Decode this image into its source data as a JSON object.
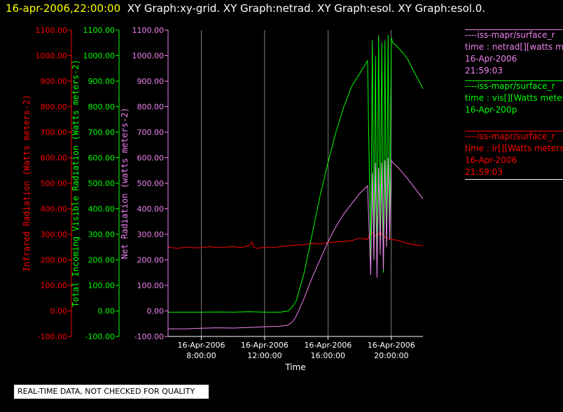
{
  "header": {
    "date": "16-apr-2006,22:00:00",
    "graphs": "XY Graph:xy-grid.  XY Graph:netrad.  XY Graph:esol.  XY Graph:esol.0."
  },
  "legend": [
    {
      "source": "----iss-mapr/surface_r",
      "variable": "time : netrad[][watts me",
      "date": "16-Apr-2006",
      "time": "21:59:03",
      "color": "#ee82ee"
    },
    {
      "source": "----iss-mapr/surface_r",
      "variable": "time : vis[][Watts meters",
      "date": "16-Apr-200p",
      "time": "",
      "color": "#00ff00"
    },
    {
      "source": "----iss-mapr/surface_r",
      "variable": "time : ir[][Watts meters",
      "date": "16-Apr-2006",
      "time": "21:59:03",
      "color": "#ff0000"
    }
  ],
  "disclaimer": "REAL-TIME DATA, NOT CHECKED FOR QUALITY",
  "colors": {
    "ir": "#ff0000",
    "vis": "#00ff00",
    "netrad": "#ee82ee",
    "grid": "#ffffff",
    "axis": "#ffffff"
  },
  "chart_data": {
    "type": "line",
    "xlabel": "Time",
    "x_ticks": [
      {
        "date": "16-Apr-2006",
        "time": "8:00:00",
        "hour": 8
      },
      {
        "date": "16-Apr-2006",
        "time": "12:00:00",
        "hour": 12
      },
      {
        "date": "16-Apr-2006",
        "time": "16:00:00",
        "hour": 16
      },
      {
        "date": "16-Apr-2006",
        "time": "20:00:00",
        "hour": 20
      }
    ],
    "xlim_hours": [
      5.9,
      22.0
    ],
    "y_axes": [
      {
        "key": "ir",
        "label": "Infrared Radiation (Watts meters-2)",
        "color": "#ff0000",
        "ticks": [
          "1100.00",
          "1000.00",
          "900.00",
          "800.00",
          "700.00",
          "600.00",
          "500.00",
          "400.00",
          "300.00",
          "200.00",
          "100.00",
          "0.00",
          "-100.00"
        ]
      },
      {
        "key": "vis",
        "label": "Total Incoming Visible Radiation (Watts meters-2)",
        "color": "#00ff00",
        "ticks": [
          "1100.00",
          "1000.00",
          "900.00",
          "800.00",
          "700.00",
          "600.00",
          "500.00",
          "400.00",
          "300.00",
          "200.00",
          "100.00",
          "0.00",
          "-100.00"
        ]
      },
      {
        "key": "netrad",
        "label": "Net Radiation (watts meters-2)",
        "color": "#ee82ee",
        "ticks": [
          "1100.00",
          "1000.00",
          "900.00",
          "800.00",
          "700.00",
          "600.00",
          "500.00",
          "400.00",
          "300.00",
          "200.00",
          "100.00",
          "0.00",
          "-100.00"
        ]
      }
    ],
    "ylim": [
      -100,
      1100
    ],
    "grid": true,
    "series": [
      {
        "key": "ir",
        "color": "#ff0000",
        "x": [
          5.9,
          6.5,
          7.0,
          7.5,
          8.0,
          8.5,
          9.0,
          9.5,
          10.0,
          10.5,
          11.0,
          11.2,
          11.3,
          11.5,
          12.0,
          12.5,
          13.0,
          13.5,
          14.0,
          14.5,
          15.0,
          15.5,
          16.0,
          16.5,
          17.0,
          17.5,
          18.0,
          18.5,
          18.7,
          18.9,
          19.1,
          19.3,
          19.5,
          19.7,
          20.0,
          20.5,
          21.0,
          21.5,
          22.0
        ],
        "y": [
          250,
          245,
          250,
          247,
          248,
          252,
          248,
          250,
          252,
          248,
          255,
          270,
          250,
          245,
          250,
          248,
          252,
          255,
          258,
          260,
          265,
          262,
          268,
          270,
          272,
          275,
          285,
          280,
          310,
          300,
          290,
          310,
          295,
          285,
          280,
          275,
          265,
          258,
          255
        ]
      },
      {
        "key": "vis",
        "color": "#00ff00",
        "x": [
          5.9,
          7.0,
          8.0,
          9.0,
          10.0,
          11.0,
          12.0,
          13.0,
          13.5,
          13.8,
          14.0,
          14.5,
          15.0,
          15.5,
          16.0,
          16.5,
          17.0,
          17.5,
          18.0,
          18.5,
          18.7,
          18.8,
          18.9,
          19.0,
          19.1,
          19.2,
          19.3,
          19.4,
          19.5,
          19.6,
          19.7,
          19.8,
          19.9,
          20.0,
          20.1,
          20.3,
          20.6,
          21.0,
          21.5,
          22.0
        ],
        "y": [
          -5,
          -5,
          -5,
          -4,
          -5,
          -3,
          -5,
          -5,
          0,
          20,
          40,
          150,
          300,
          450,
          580,
          700,
          800,
          880,
          930,
          980,
          200,
          1060,
          250,
          1000,
          150,
          1080,
          300,
          1050,
          150,
          1060,
          250,
          1080,
          300,
          1070,
          1050,
          1040,
          1020,
          990,
          930,
          870
        ]
      },
      {
        "key": "netrad",
        "color": "#ee82ee",
        "x": [
          5.9,
          7.0,
          8.0,
          9.0,
          10.0,
          11.0,
          12.0,
          13.0,
          13.5,
          13.8,
          14.0,
          14.5,
          15.0,
          15.5,
          16.0,
          16.5,
          17.0,
          17.5,
          18.0,
          18.5,
          18.7,
          18.8,
          18.9,
          19.0,
          19.1,
          19.2,
          19.3,
          19.4,
          19.5,
          19.6,
          19.7,
          19.8,
          19.9,
          20.0,
          20.1,
          20.3,
          20.6,
          21.0,
          21.5,
          22.0
        ],
        "y": [
          -70,
          -70,
          -68,
          -66,
          -67,
          -65,
          -62,
          -60,
          -55,
          -40,
          -20,
          50,
          130,
          200,
          270,
          330,
          380,
          420,
          460,
          490,
          140,
          540,
          200,
          580,
          130,
          560,
          220,
          580,
          160,
          590,
          250,
          600,
          280,
          590,
          580,
          570,
          550,
          520,
          480,
          440
        ]
      }
    ]
  }
}
